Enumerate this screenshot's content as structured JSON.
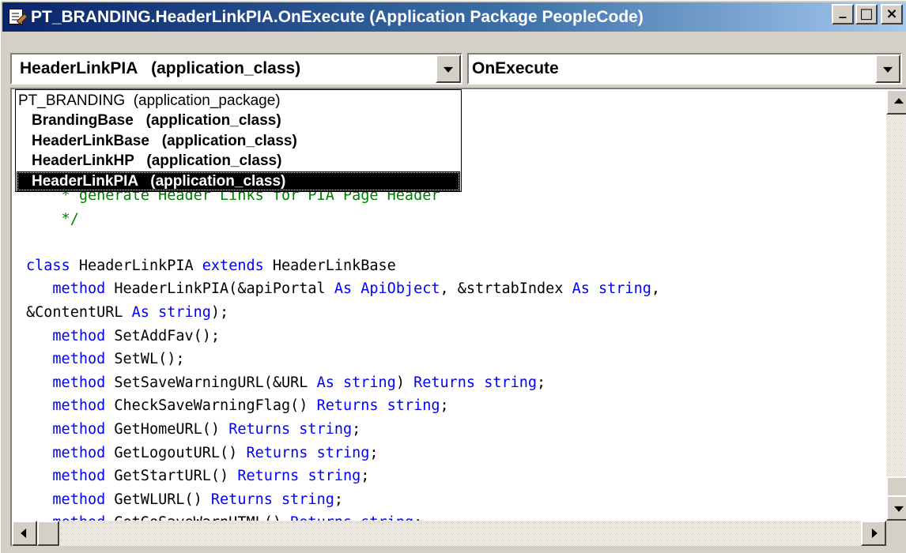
{
  "window": {
    "title": "PT_BRANDING.HeaderLinkPIA.OnExecute (Application Package PeopleCode)",
    "icon": "peoplecode-editor-icon",
    "controls": {
      "minimize": "_",
      "maximize": "□",
      "close": "×"
    }
  },
  "class_combo": {
    "value": "HeaderLinkPIA   (application_class)"
  },
  "event_combo": {
    "value": "OnExecute"
  },
  "dropdown": {
    "items": [
      {
        "label": "PT_BRANDING  (application_package)",
        "kind": "package",
        "selected": false
      },
      {
        "label": "BrandingBase   (application_class)",
        "kind": "class",
        "selected": false
      },
      {
        "label": "HeaderLinkBase   (application_class)",
        "kind": "class",
        "selected": false
      },
      {
        "label": "HeaderLinkHP   (application_class)",
        "kind": "class",
        "selected": false
      },
      {
        "label": "HeaderLinkPIA   (application_class)",
        "kind": "class",
        "selected": true
      }
    ]
  },
  "code_lines": [
    [
      [
        "cm",
        "    * generate Header Links for PIA Page Header"
      ]
    ],
    [
      [
        "cm",
        "    */"
      ]
    ],
    [],
    [
      [
        "kw",
        "class"
      ],
      [
        "",
        " HeaderLinkPIA "
      ],
      [
        "kw",
        "extends"
      ],
      [
        "",
        " HeaderLinkBase"
      ]
    ],
    [
      [
        "",
        "   "
      ],
      [
        "kw",
        "method"
      ],
      [
        "",
        " HeaderLinkPIA(&apiPortal "
      ],
      [
        "kw",
        "As"
      ],
      [
        "",
        " "
      ],
      [
        "kw",
        "ApiObject"
      ],
      [
        "",
        ", &strtabIndex "
      ],
      [
        "kw",
        "As"
      ],
      [
        "",
        " "
      ],
      [
        "kw",
        "string"
      ],
      [
        "",
        ","
      ]
    ],
    [
      [
        "",
        "&ContentURL "
      ],
      [
        "kw",
        "As"
      ],
      [
        "",
        " "
      ],
      [
        "kw",
        "string"
      ],
      [
        "",
        ");"
      ]
    ],
    [
      [
        "",
        "   "
      ],
      [
        "kw",
        "method"
      ],
      [
        "",
        " SetAddFav();"
      ]
    ],
    [
      [
        "",
        "   "
      ],
      [
        "kw",
        "method"
      ],
      [
        "",
        " SetWL();"
      ]
    ],
    [
      [
        "",
        "   "
      ],
      [
        "kw",
        "method"
      ],
      [
        "",
        " SetSaveWarningURL(&URL "
      ],
      [
        "kw",
        "As"
      ],
      [
        "",
        " "
      ],
      [
        "kw",
        "string"
      ],
      [
        "",
        ") "
      ],
      [
        "kw",
        "Returns"
      ],
      [
        "",
        " "
      ],
      [
        "kw",
        "string"
      ],
      [
        "",
        ";"
      ]
    ],
    [
      [
        "",
        "   "
      ],
      [
        "kw",
        "method"
      ],
      [
        "",
        " CheckSaveWarningFlag() "
      ],
      [
        "kw",
        "Returns"
      ],
      [
        "",
        " "
      ],
      [
        "kw",
        "string"
      ],
      [
        "",
        ";"
      ]
    ],
    [
      [
        "",
        "   "
      ],
      [
        "kw",
        "method"
      ],
      [
        "",
        " GetHomeURL() "
      ],
      [
        "kw",
        "Returns"
      ],
      [
        "",
        " "
      ],
      [
        "kw",
        "string"
      ],
      [
        "",
        ";"
      ]
    ],
    [
      [
        "",
        "   "
      ],
      [
        "kw",
        "method"
      ],
      [
        "",
        " GetLogoutURL() "
      ],
      [
        "kw",
        "Returns"
      ],
      [
        "",
        " "
      ],
      [
        "kw",
        "string"
      ],
      [
        "",
        ";"
      ]
    ],
    [
      [
        "",
        "   "
      ],
      [
        "kw",
        "method"
      ],
      [
        "",
        " GetStartURL() "
      ],
      [
        "kw",
        "Returns"
      ],
      [
        "",
        " "
      ],
      [
        "kw",
        "string"
      ],
      [
        "",
        ";"
      ]
    ],
    [
      [
        "",
        "   "
      ],
      [
        "kw",
        "method"
      ],
      [
        "",
        " GetWLURL() "
      ],
      [
        "kw",
        "Returns"
      ],
      [
        "",
        " "
      ],
      [
        "kw",
        "string"
      ],
      [
        "",
        ";"
      ]
    ],
    [
      [
        "",
        "   "
      ],
      [
        "kw",
        "method"
      ],
      [
        "",
        " GetGoSaveWarnHTML() "
      ],
      [
        "kw",
        "Returns"
      ],
      [
        "",
        " "
      ],
      [
        "kw",
        "string"
      ],
      [
        "",
        ";"
      ]
    ]
  ],
  "colors": {
    "keyword": "#0000ff",
    "comment": "#008000",
    "text": "#000000",
    "title_bar_start": "#0a246a",
    "title_bar_end": "#a6caf0"
  }
}
